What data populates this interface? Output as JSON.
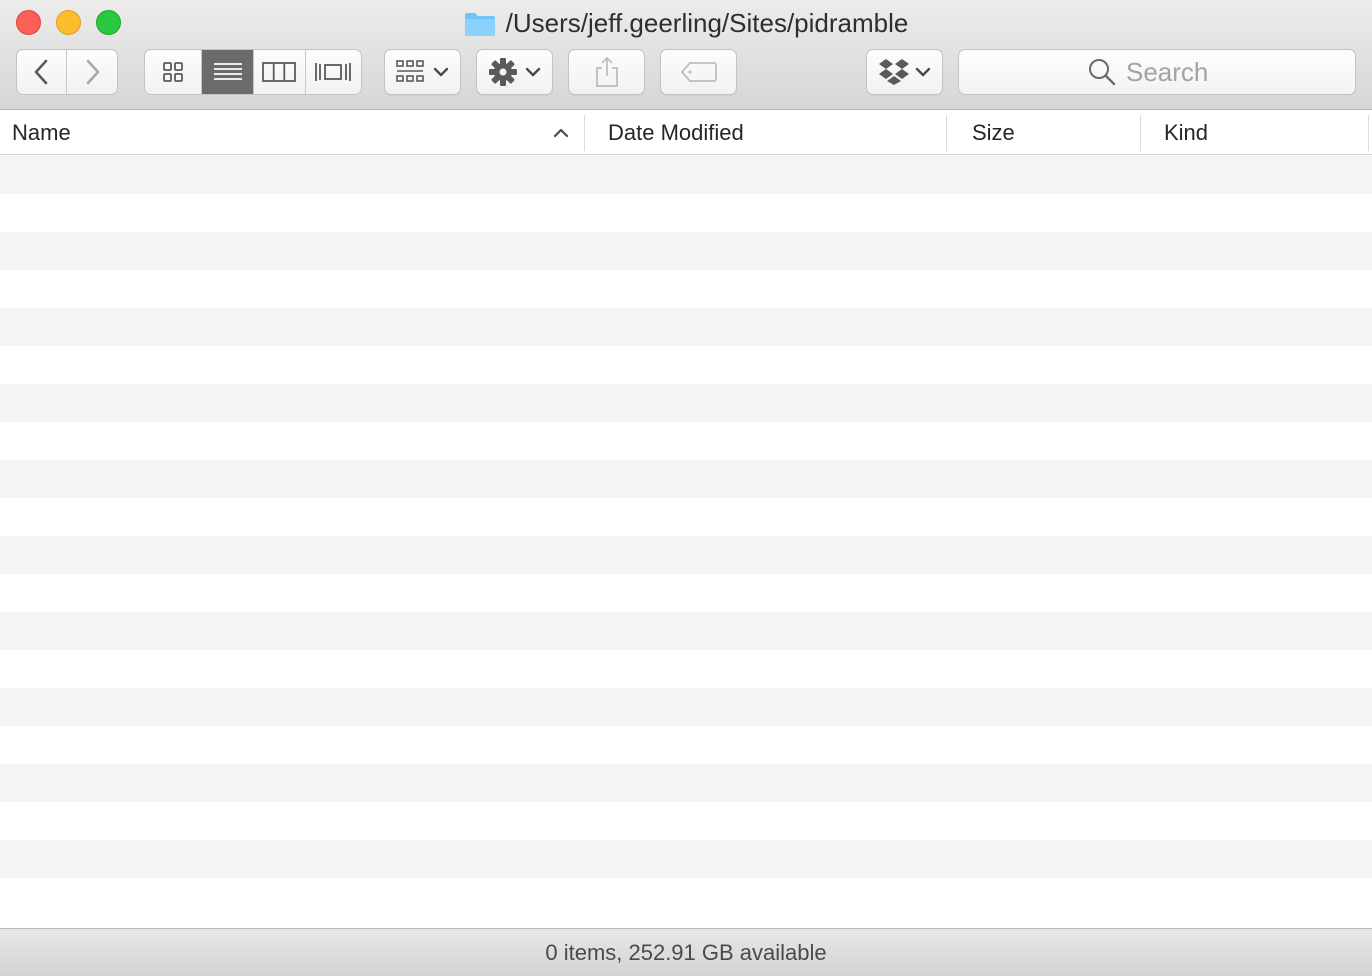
{
  "window": {
    "title": "/Users/jeff.geerling/Sites/pidramble",
    "title_icon": "folder-icon"
  },
  "toolbar": {
    "back_icon": "chevron-left-icon",
    "forward_icon": "chevron-right-icon",
    "view_modes": [
      "icon-view-icon",
      "list-view-icon",
      "column-view-icon",
      "cover-flow-icon"
    ],
    "active_view": "list-view-icon",
    "arrange_icon": "arrange-grid-icon",
    "action_icon": "gear-icon",
    "share_icon": "share-icon",
    "tag_icon": "tag-icon",
    "dropbox_icon": "dropbox-icon"
  },
  "search": {
    "placeholder": "Search",
    "value": ""
  },
  "columns": {
    "name": "Name",
    "date_modified": "Date Modified",
    "size": "Size",
    "kind": "Kind",
    "sort_indicator": "sort-ascending-icon"
  },
  "rows": [],
  "status": {
    "text": "0 items, 252.91 GB available"
  },
  "colors": {
    "close": "#fc5f57",
    "minimize": "#fdbc2e",
    "zoom": "#28c840",
    "folder": "#6fc3f7",
    "active_segment": "#6b6b6b",
    "stripe": "#f4f4f4"
  }
}
